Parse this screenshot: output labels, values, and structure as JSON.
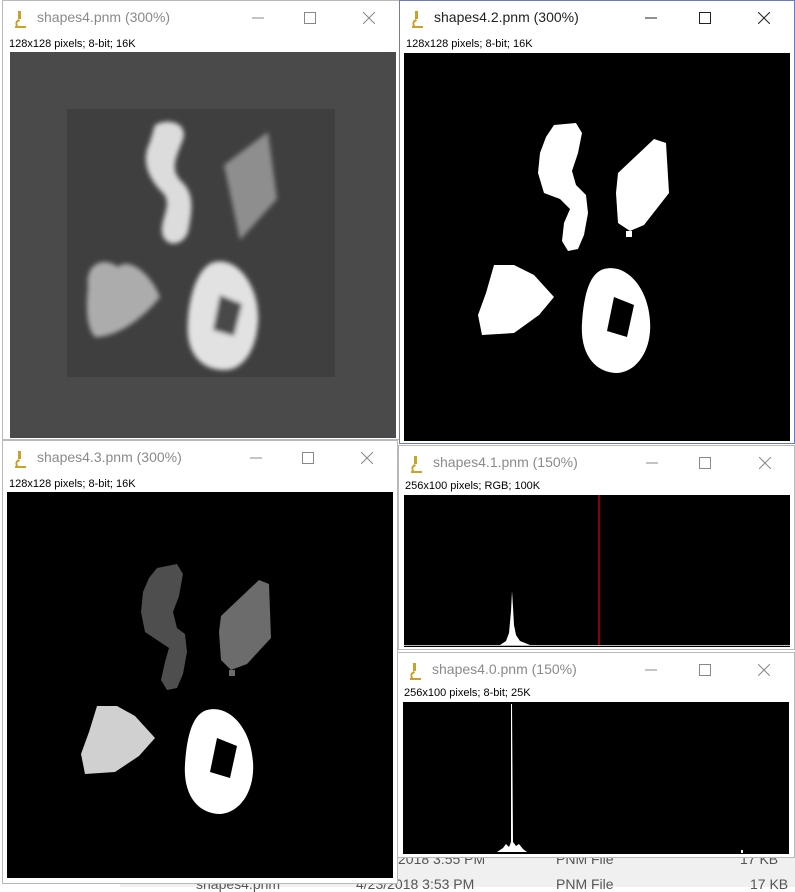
{
  "windows": [
    {
      "id": "w1",
      "title": "shapes4.pnm (300%)",
      "info": "128x128 pixels; 8-bit; 16K"
    },
    {
      "id": "w2",
      "title": "shapes4.2.pnm (300%)",
      "info": "128x128 pixels; 8-bit; 16K"
    },
    {
      "id": "w3",
      "title": "shapes4.3.pnm (300%)",
      "info": "128x128 pixels; 8-bit; 16K"
    },
    {
      "id": "w4",
      "title": "shapes4.1.pnm (150%)",
      "info": "256x100 pixels; RGB; 100K"
    },
    {
      "id": "w5",
      "title": "shapes4.0.pnm (150%)",
      "info": "256x100 pixels; 8-bit; 25K"
    }
  ],
  "background_explorer": {
    "row1": {
      "modified": "2018 3:55 PM",
      "type": "PNM File",
      "size": "17 KB"
    },
    "row2": {
      "name": "shapes4.pnm",
      "modified": "4/23/2018 3:53 PM",
      "type": "PNM File",
      "size": "17 KB"
    }
  },
  "colors": {
    "active_border": "#6c7bbf",
    "threshold_line": "#c00000",
    "icon": "#c9a227"
  },
  "icons": {
    "app": "microscope-icon",
    "minimize": "minimize-icon",
    "maximize": "maximize-icon",
    "close": "close-icon"
  }
}
